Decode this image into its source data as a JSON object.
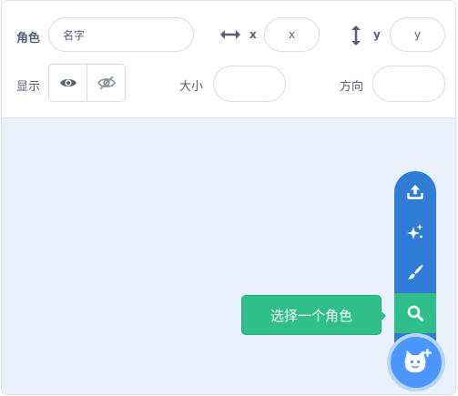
{
  "sprite_info": {
    "sprite_label": "角色",
    "name_placeholder": "名字",
    "x_label": "x",
    "x_placeholder": "x",
    "y_label": "y",
    "y_placeholder": "y",
    "show_label": "显示",
    "size_label": "大小",
    "direction_label": "方向",
    "size_value": "",
    "direction_value": ""
  },
  "sprite_menu": {
    "items": [
      {
        "icon": "upload-icon"
      },
      {
        "icon": "surprise-sparkle-icon"
      },
      {
        "icon": "paint-brush-icon"
      },
      {
        "icon": "search-icon"
      }
    ],
    "tooltip": "选择一个角色",
    "main_icon": "cat-add-icon"
  },
  "colors": {
    "menu_blue": "#2f7dd6",
    "active_green": "#2ebf8a",
    "fab_blue": "#4c97ff",
    "background": "#e9f1fc"
  }
}
